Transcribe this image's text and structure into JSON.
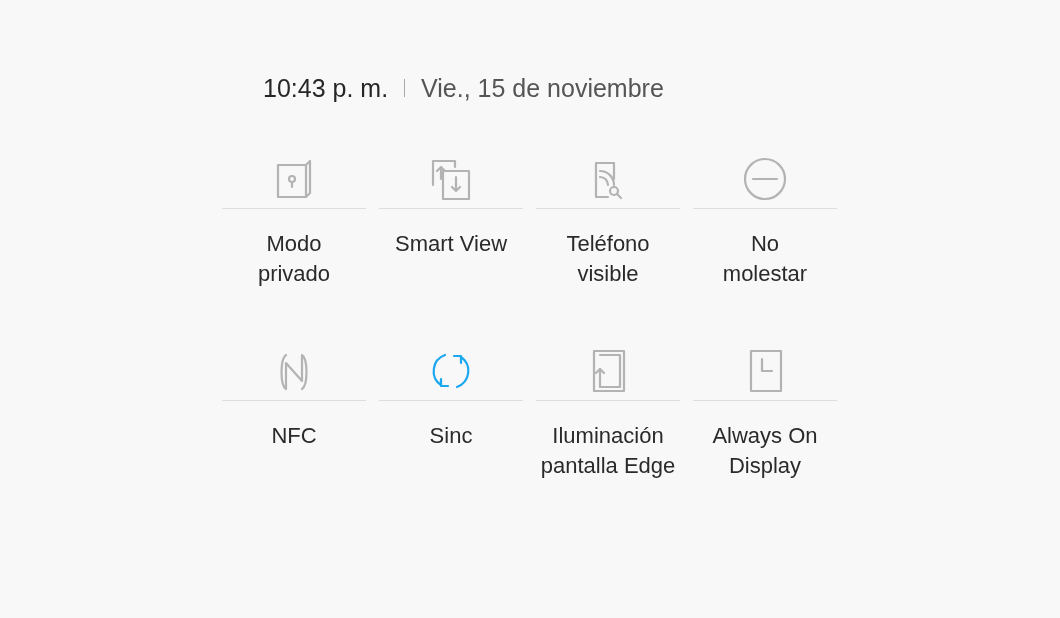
{
  "header": {
    "time": "10:43 p. m.",
    "date": "Vie., 15 de noviembre"
  },
  "tiles": [
    {
      "kind": "private",
      "label": "Modo\nprivado",
      "on": false
    },
    {
      "kind": "smartview",
      "label": "Smart View",
      "on": false
    },
    {
      "kind": "visible",
      "label": "Teléfono\nvisible",
      "on": false
    },
    {
      "kind": "dnd",
      "label": "No\nmolestar",
      "on": false
    },
    {
      "kind": "nfc",
      "label": "NFC",
      "on": false
    },
    {
      "kind": "sync",
      "label": "Sinc",
      "on": true
    },
    {
      "kind": "edge",
      "label": "Iluminación\npantalla Edge",
      "on": false
    },
    {
      "kind": "aod",
      "label": "Always On\nDisplay",
      "on": false
    }
  ]
}
